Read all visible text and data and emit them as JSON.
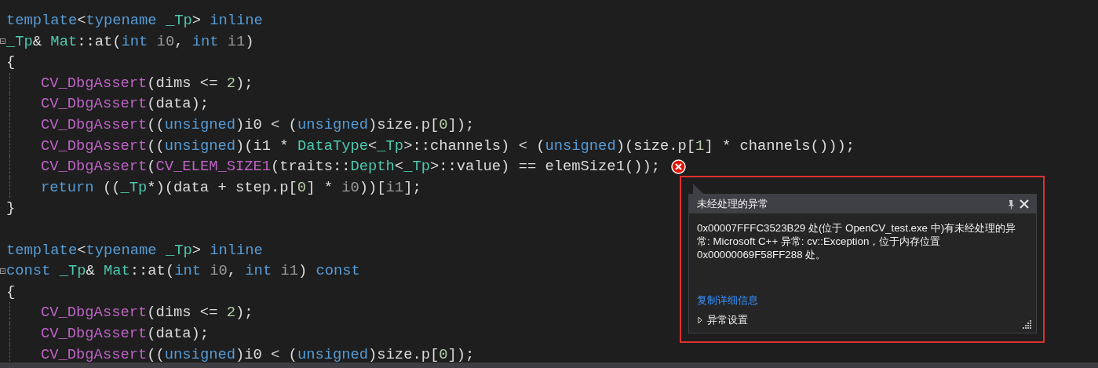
{
  "code_lines": [
    {
      "kind": "code",
      "tokens": [
        {
          "text": "template",
          "kind": "keyword"
        },
        {
          "text": "<",
          "kind": "plain"
        },
        {
          "text": "typename",
          "kind": "keyword"
        },
        {
          "text": " _Tp",
          "kind": "type"
        },
        {
          "text": "> ",
          "kind": "plain"
        },
        {
          "text": "inline",
          "kind": "keyword"
        }
      ]
    },
    {
      "kind": "code",
      "foldable": true,
      "tokens": [
        {
          "text": "_Tp",
          "kind": "type"
        },
        {
          "text": "& ",
          "kind": "plain"
        },
        {
          "text": "Mat",
          "kind": "type"
        },
        {
          "text": "::at(",
          "kind": "plain"
        },
        {
          "text": "int",
          "kind": "keyword"
        },
        {
          "text": " i0",
          "kind": "param"
        },
        {
          "text": ", ",
          "kind": "plain"
        },
        {
          "text": "int",
          "kind": "keyword"
        },
        {
          "text": " i1",
          "kind": "param"
        },
        {
          "text": ")",
          "kind": "plain"
        }
      ]
    },
    {
      "kind": "code",
      "tokens": [
        {
          "text": "{",
          "kind": "plain"
        }
      ]
    },
    {
      "kind": "code",
      "indented": true,
      "tokens": [
        {
          "text": "CV_DbgAssert",
          "kind": "macro"
        },
        {
          "text": "(dims <= ",
          "kind": "plain"
        },
        {
          "text": "2",
          "kind": "number"
        },
        {
          "text": ");",
          "kind": "plain"
        }
      ]
    },
    {
      "kind": "code",
      "indented": true,
      "tokens": [
        {
          "text": "CV_DbgAssert",
          "kind": "macro"
        },
        {
          "text": "(data);",
          "kind": "plain"
        }
      ]
    },
    {
      "kind": "code",
      "indented": true,
      "tokens": [
        {
          "text": "CV_DbgAssert",
          "kind": "macro"
        },
        {
          "text": "((",
          "kind": "plain"
        },
        {
          "text": "unsigned",
          "kind": "keyword"
        },
        {
          "text": ")i0 < (",
          "kind": "plain"
        },
        {
          "text": "unsigned",
          "kind": "keyword"
        },
        {
          "text": ")size.p[",
          "kind": "plain"
        },
        {
          "text": "0",
          "kind": "number"
        },
        {
          "text": "]);",
          "kind": "plain"
        }
      ]
    },
    {
      "kind": "code",
      "indented": true,
      "tokens": [
        {
          "text": "CV_DbgAssert",
          "kind": "macro"
        },
        {
          "text": "((",
          "kind": "plain"
        },
        {
          "text": "unsigned",
          "kind": "keyword"
        },
        {
          "text": ")(i1 * ",
          "kind": "plain"
        },
        {
          "text": "DataType",
          "kind": "type"
        },
        {
          "text": "<",
          "kind": "plain"
        },
        {
          "text": "_Tp",
          "kind": "type"
        },
        {
          "text": ">::channels) < (",
          "kind": "plain"
        },
        {
          "text": "unsigned",
          "kind": "keyword"
        },
        {
          "text": ")(size.p[",
          "kind": "plain"
        },
        {
          "text": "1",
          "kind": "number"
        },
        {
          "text": "] * channels()));",
          "kind": "plain"
        }
      ]
    },
    {
      "kind": "code",
      "indented": true,
      "has_error": true,
      "tokens": [
        {
          "text": "CV_DbgAssert",
          "kind": "macro"
        },
        {
          "text": "(",
          "kind": "plain"
        },
        {
          "text": "CV_ELEM_SIZE1",
          "kind": "macro"
        },
        {
          "text": "(traits::",
          "kind": "plain"
        },
        {
          "text": "Depth",
          "kind": "type"
        },
        {
          "text": "<",
          "kind": "plain"
        },
        {
          "text": "_Tp",
          "kind": "type"
        },
        {
          "text": ">::value) == elemSize1());",
          "kind": "plain"
        }
      ]
    },
    {
      "kind": "code",
      "indented": true,
      "tokens": [
        {
          "text": "return",
          "kind": "keyword"
        },
        {
          "text": " ((",
          "kind": "plain"
        },
        {
          "text": "_Tp",
          "kind": "type"
        },
        {
          "text": "*)(data + step.p[",
          "kind": "plain"
        },
        {
          "text": "0",
          "kind": "number"
        },
        {
          "text": "] * ",
          "kind": "plain"
        },
        {
          "text": "i0",
          "kind": "param"
        },
        {
          "text": "))[",
          "kind": "plain"
        },
        {
          "text": "i1",
          "kind": "param"
        },
        {
          "text": "];",
          "kind": "plain"
        }
      ]
    },
    {
      "kind": "code",
      "tokens": [
        {
          "text": "}",
          "kind": "plain"
        }
      ]
    },
    {
      "kind": "blank"
    },
    {
      "kind": "code",
      "tokens": [
        {
          "text": "template",
          "kind": "keyword"
        },
        {
          "text": "<",
          "kind": "plain"
        },
        {
          "text": "typename",
          "kind": "keyword"
        },
        {
          "text": " _Tp",
          "kind": "type"
        },
        {
          "text": "> ",
          "kind": "plain"
        },
        {
          "text": "inline",
          "kind": "keyword"
        }
      ]
    },
    {
      "kind": "code",
      "foldable": true,
      "tokens": [
        {
          "text": "const",
          "kind": "keyword"
        },
        {
          "text": " _Tp",
          "kind": "type"
        },
        {
          "text": "& ",
          "kind": "plain"
        },
        {
          "text": "Mat",
          "kind": "type"
        },
        {
          "text": "::at(",
          "kind": "plain"
        },
        {
          "text": "int",
          "kind": "keyword"
        },
        {
          "text": " i0",
          "kind": "param"
        },
        {
          "text": ", ",
          "kind": "plain"
        },
        {
          "text": "int",
          "kind": "keyword"
        },
        {
          "text": " i1",
          "kind": "param"
        },
        {
          "text": ") ",
          "kind": "plain"
        },
        {
          "text": "const",
          "kind": "keyword"
        }
      ]
    },
    {
      "kind": "code",
      "tokens": [
        {
          "text": "{",
          "kind": "plain"
        }
      ]
    },
    {
      "kind": "code",
      "indented": true,
      "tokens": [
        {
          "text": "CV_DbgAssert",
          "kind": "macro"
        },
        {
          "text": "(dims <= ",
          "kind": "plain"
        },
        {
          "text": "2",
          "kind": "number"
        },
        {
          "text": ");",
          "kind": "plain"
        }
      ]
    },
    {
      "kind": "code",
      "indented": true,
      "tokens": [
        {
          "text": "CV_DbgAssert",
          "kind": "macro"
        },
        {
          "text": "(data);",
          "kind": "plain"
        }
      ]
    },
    {
      "kind": "code",
      "indented": true,
      "tokens": [
        {
          "text": "CV_DbgAssert",
          "kind": "macro"
        },
        {
          "text": "((",
          "kind": "plain"
        },
        {
          "text": "unsigned",
          "kind": "keyword"
        },
        {
          "text": ")i0 < (",
          "kind": "plain"
        },
        {
          "text": "unsigned",
          "kind": "keyword"
        },
        {
          "text": ")size.p[",
          "kind": "plain"
        },
        {
          "text": "0",
          "kind": "number"
        },
        {
          "text": "]);",
          "kind": "plain"
        }
      ]
    }
  ],
  "error_popup": {
    "title": "未经处理的异常",
    "message": "0x00007FFFC3523B29 处(位于 OpenCV_test.exe 中)有未经处理的异常: Microsoft C++ 异常: cv::Exception，位于内存位置 0x00000069F58FF288 处。",
    "copy_link": "复制详细信息",
    "settings": {
      "label": "异常设置",
      "expanded": false
    }
  }
}
